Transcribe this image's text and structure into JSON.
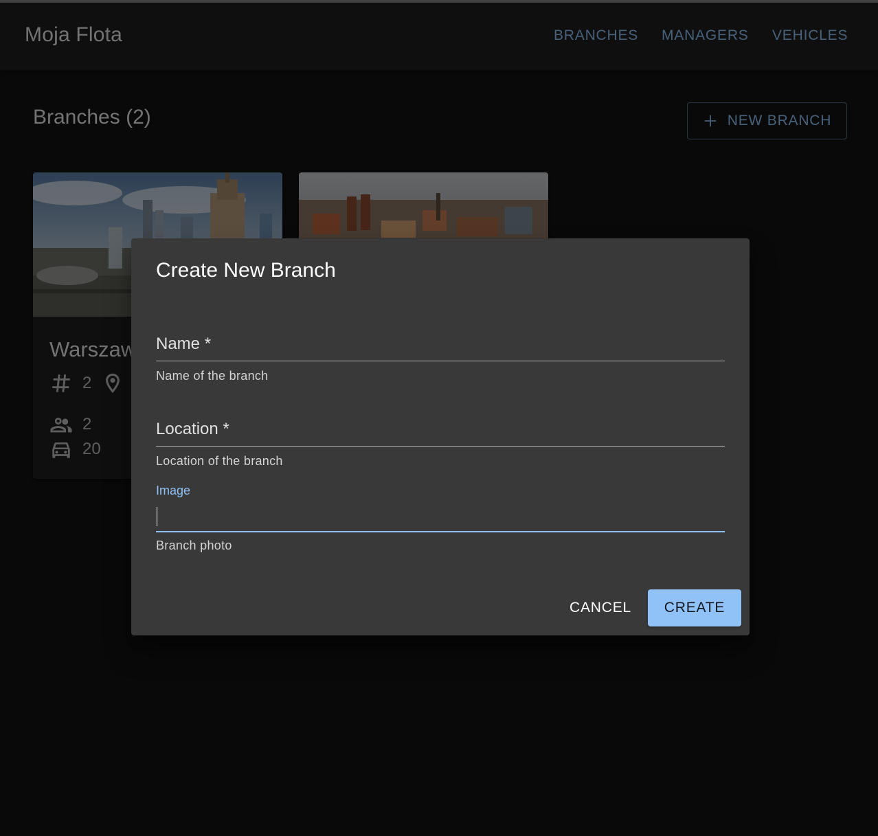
{
  "app": {
    "title": "Moja Flota"
  },
  "nav": {
    "items": [
      {
        "label": "BRANCHES"
      },
      {
        "label": "MANAGERS"
      },
      {
        "label": "VEHICLES"
      }
    ]
  },
  "page": {
    "title": "Branches (2)",
    "new_button_label": "NEW BRANCH"
  },
  "cards": [
    {
      "name": "Warszawa",
      "branch_count": "2",
      "managers": "2",
      "vehicles": "20"
    },
    {
      "name": ""
    }
  ],
  "dialog": {
    "title": "Create New Branch",
    "fields": {
      "name": {
        "label": "Name *",
        "helper": "Name of the branch",
        "value": ""
      },
      "location": {
        "label": "Location *",
        "helper": "Location of the branch",
        "value": ""
      },
      "image": {
        "label": "Image",
        "helper": "Branch photo",
        "value": ""
      }
    },
    "cancel_label": "CANCEL",
    "create_label": "CREATE"
  },
  "colors": {
    "accent": "#90c2f7",
    "background": "#121212",
    "surface": "#1e1e1e",
    "dialog": "#393939"
  }
}
